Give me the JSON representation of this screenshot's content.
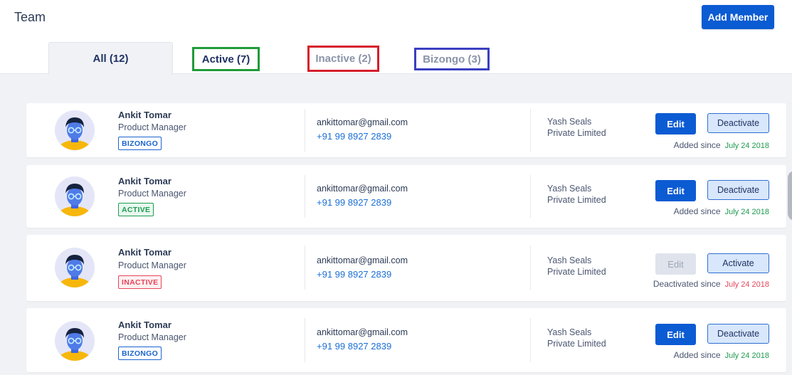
{
  "header": {
    "title": "Team",
    "add_member_label": "Add Member"
  },
  "tabs": [
    {
      "label": "All (12)"
    },
    {
      "label": "Active (7)"
    },
    {
      "label": "Inactive (2)"
    },
    {
      "label": "Bizongo (3)"
    }
  ],
  "members": [
    {
      "name": "Ankit Tomar",
      "role": "Product Manager",
      "badge": "BIZONGO",
      "email": "ankittomar@gmail.com",
      "phone": "+91 99 8927 2839",
      "company_line1": "Yash Seals",
      "company_line2": "Private Limited",
      "edit_label": "Edit",
      "state_action": "Deactivate",
      "since_label": "Added since",
      "since_date": "July 24 2018"
    },
    {
      "name": "Ankit Tomar",
      "role": "Product Manager",
      "badge": "ACTIVE",
      "email": "ankittomar@gmail.com",
      "phone": "+91 99 8927 2839",
      "company_line1": "Yash Seals",
      "company_line2": "Private Limited",
      "edit_label": "Edit",
      "state_action": "Deactivate",
      "since_label": "Added since",
      "since_date": "July 24 2018"
    },
    {
      "name": "Ankit Tomar",
      "role": "Product Manager",
      "badge": "INACTIVE",
      "email": "ankittomar@gmail.com",
      "phone": "+91 99 8927 2839",
      "company_line1": "Yash Seals",
      "company_line2": "Private Limited",
      "edit_label": "Edit",
      "state_action": "Activate",
      "since_label": "Deactivated since",
      "since_date": "July 24 2018"
    },
    {
      "name": "Ankit Tomar",
      "role": "Product Manager",
      "badge": "BIZONGO",
      "email": "ankittomar@gmail.com",
      "phone": "+91 99 8927 2839",
      "company_line1": "Yash Seals",
      "company_line2": "Private Limited",
      "edit_label": "Edit",
      "state_action": "Deactivate",
      "since_label": "Added since",
      "since_date": "July 24 2018"
    }
  ],
  "colors": {
    "primary": "#0b5bd3",
    "active_green": "#1e9b4f",
    "inactive_red": "#e4465a",
    "tab_active_highlight": "#1f9b3a",
    "tab_inactive_highlight": "#d61f2c",
    "tab_bizongo_highlight": "#3b3fbf"
  },
  "icons": {
    "avatar": "user-avatar-icon"
  }
}
